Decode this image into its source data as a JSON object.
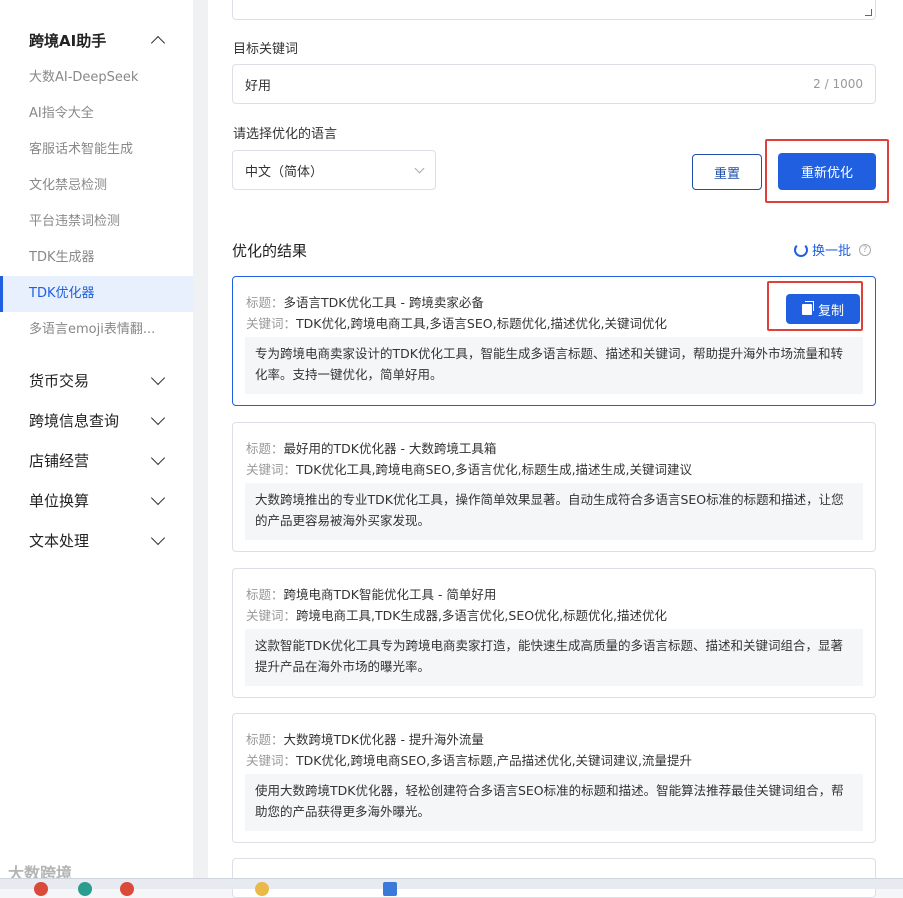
{
  "sidebar": {
    "group_ai": "跨境AI助手",
    "ai_items": [
      "大数AI-DeepSeek",
      "AI指令大全",
      "客服话术智能生成",
      "文化禁忌检测",
      "平台违禁词检测",
      "TDK生成器",
      "TDK优化器",
      "多语言emoji表情翻..."
    ],
    "groups": [
      "货币交易",
      "跨境信息查询",
      "店铺经营",
      "单位换算",
      "文本处理"
    ]
  },
  "form": {
    "keyword_label": "目标关键词",
    "keyword_value": "好用",
    "keyword_count": "2 / 1000",
    "language_label": "请选择优化的语言",
    "language_value": "中文（简体）",
    "reset_label": "重置",
    "reoptimize_label": "重新优化"
  },
  "results": {
    "title": "优化的结果",
    "refresh_label": "换一批",
    "title_prefix": "标题：",
    "keywords_prefix": "关键词：",
    "copy_label": "复制",
    "items": [
      {
        "title": "多语言TDK优化工具 - 跨境卖家必备",
        "keywords": "TDK优化,跨境电商工具,多语言SEO,标题优化,描述优化,关键词优化",
        "description": "专为跨境电商卖家设计的TDK优化工具，智能生成多语言标题、描述和关键词，帮助提升海外市场流量和转化率。支持一键优化，简单好用。"
      },
      {
        "title": "最好用的TDK优化器 - 大数跨境工具箱",
        "keywords": "TDK优化工具,跨境电商SEO,多语言优化,标题生成,描述生成,关键词建议",
        "description": "大数跨境推出的专业TDK优化工具，操作简单效果显著。自动生成符合多语言SEO标准的标题和描述，让您的产品更容易被海外买家发现。"
      },
      {
        "title": "跨境电商TDK智能优化工具 - 简单好用",
        "keywords": "跨境电商工具,TDK生成器,多语言优化,SEO优化,标题优化,描述优化",
        "description": "这款智能TDK优化工具专为跨境电商卖家打造，能快速生成高质量的多语言标题、描述和关键词组合，显著提升产品在海外市场的曝光率。"
      },
      {
        "title": "大数跨境TDK优化器 - 提升海外流量",
        "keywords": "TDK优化,跨境电商SEO,多语言标题,产品描述优化,关键词建议,流量提升",
        "description": "使用大数跨境TDK优化器，轻松创建符合多语言SEO标准的标题和描述。智能算法推荐最佳关键词组合，帮助您的产品获得更多海外曝光。"
      }
    ]
  },
  "watermark": "大数跨境",
  "colors": {
    "accent": "#1f5fe0",
    "highlight_box": "#e0403a"
  }
}
